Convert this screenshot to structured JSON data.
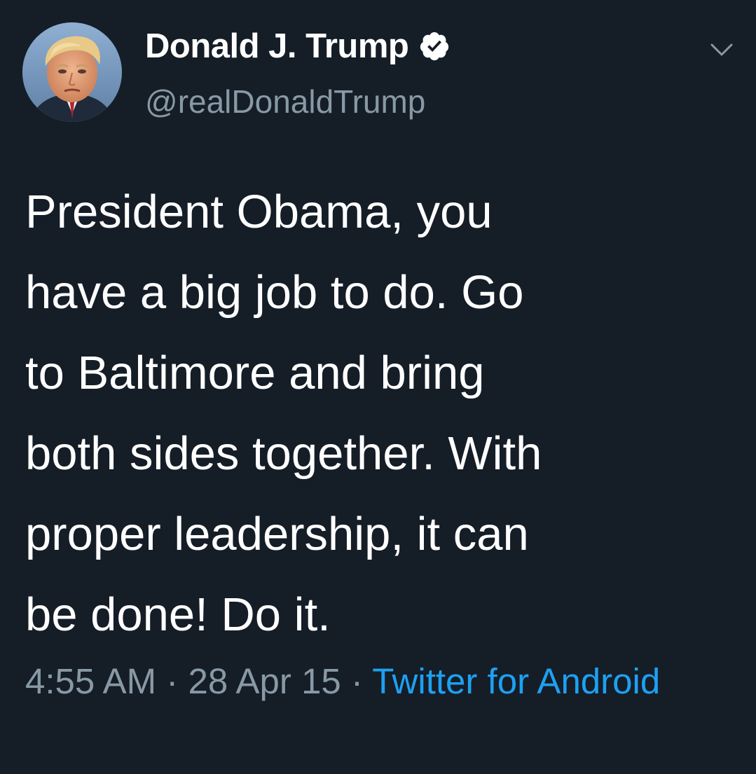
{
  "author": {
    "display_name": "Donald J. Trump",
    "handle": "@realDonaldTrump",
    "verified": true
  },
  "icons": {
    "avatar": "profile-photo",
    "verified": "verified-badge-icon",
    "menu": "chevron-down-icon"
  },
  "tweet": {
    "text": "President Obama, you\nhave a big job to do. Go\nto Baltimore and bring\nboth sides together. With\nproper leadership, it can\nbe done! Do it."
  },
  "meta": {
    "time": "4:55 AM",
    "separator": " · ",
    "date": "28 Apr 15",
    "source": "Twitter for Android"
  },
  "colors": {
    "background": "#151d27",
    "text": "#ffffff",
    "secondary": "#8899a6",
    "link": "#1da1f2"
  }
}
